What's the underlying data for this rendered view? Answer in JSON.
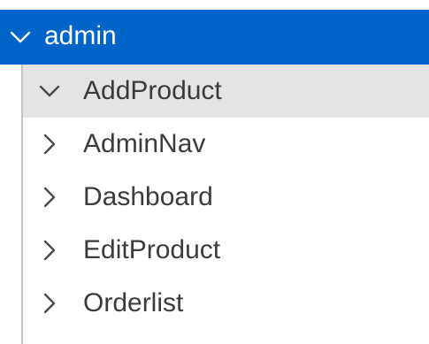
{
  "tree": {
    "root": {
      "label": "admin",
      "icon": "chevron-down-icon",
      "expanded": true
    },
    "children": [
      {
        "label": "AddProduct",
        "icon": "chevron-down-icon",
        "expanded": true,
        "selected": true
      },
      {
        "label": "AdminNav",
        "icon": "chevron-right-icon",
        "expanded": false
      },
      {
        "label": "Dashboard",
        "icon": "chevron-right-icon",
        "expanded": false
      },
      {
        "label": "EditProduct",
        "icon": "chevron-right-icon",
        "expanded": false
      },
      {
        "label": "Orderlist",
        "icon": "chevron-right-icon",
        "expanded": false
      }
    ]
  },
  "colors": {
    "accent": "#0064c8",
    "selected_row": "#e4e4e4",
    "text": "#3b3b3b",
    "guide_line": "#c2c2c2"
  }
}
